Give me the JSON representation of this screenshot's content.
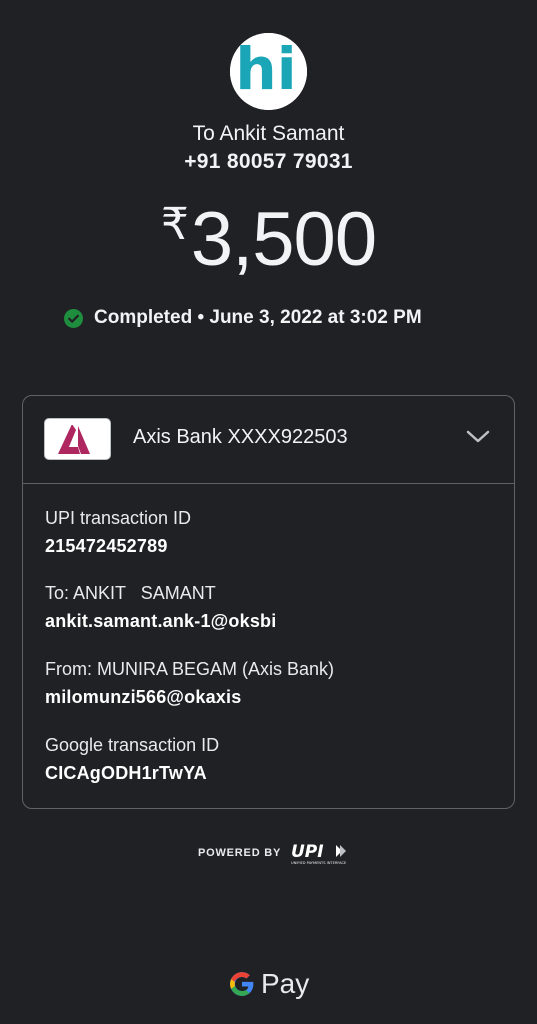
{
  "recipient": {
    "avatar_text": "hi",
    "name": "To Ankit Samant",
    "phone": "+91 80057 79031"
  },
  "payment": {
    "currency_symbol": "₹",
    "amount": "3,500",
    "status": "Completed • June 3, 2022 at 3:02 PM"
  },
  "account": {
    "bank_name": "Axis Bank XXXX922503"
  },
  "details": [
    {
      "label": "UPI transaction ID",
      "value": "215472452789"
    },
    {
      "label": "To: ANKIT   SAMANT",
      "value": "ankit.samant.ank-1@oksbi"
    },
    {
      "label": "From: MUNIRA BEGAM (Axis Bank)",
      "value": "milomunzi566@okaxis"
    },
    {
      "label": "Google transaction ID",
      "value": "CICAgODH1rTwYA"
    }
  ],
  "footer": {
    "powered_by": "POWERED BY",
    "upi_text": "UPI",
    "upi_subtext": "UNIFIED PAYMENTS INTERFACE",
    "gpay_text": "Pay"
  },
  "colors": {
    "background": "#202124",
    "success_green": "#1e8e3e",
    "axis_maroon": "#ae275f",
    "avatar_teal": "#1aa6b7"
  },
  "icons": {
    "status": "check-circle-icon",
    "expand": "chevron-down-icon",
    "bank": "axis-bank-logo",
    "google": "google-g-logo"
  }
}
